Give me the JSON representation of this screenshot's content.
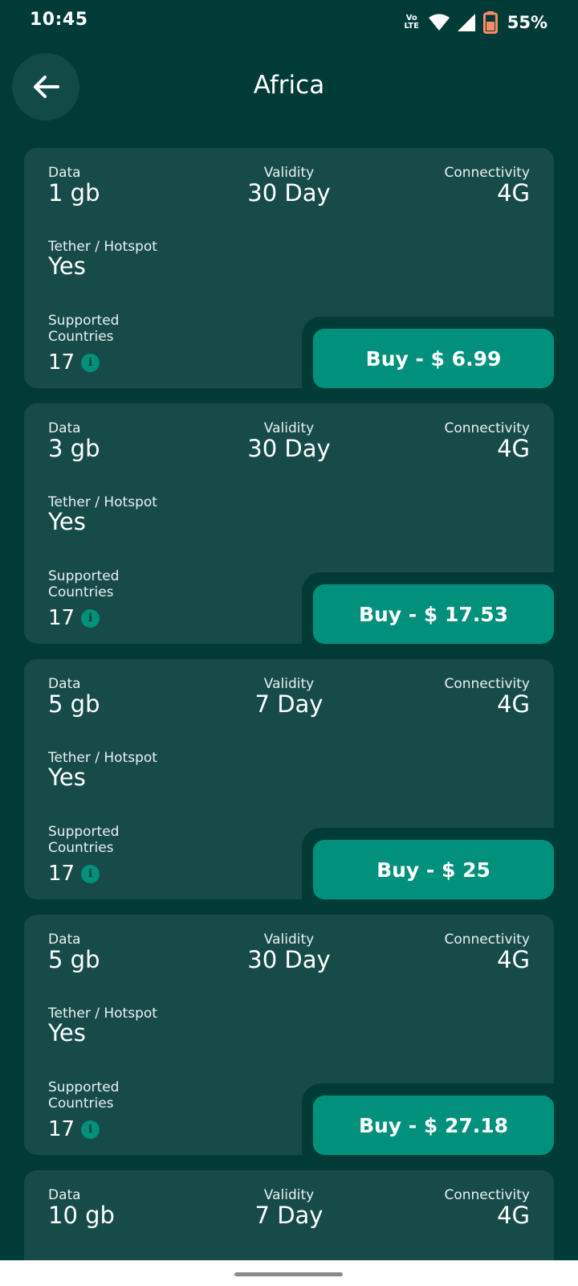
{
  "status": {
    "time": "10:45",
    "volte": "Vo LTE",
    "battery": "55%"
  },
  "header": {
    "title": "Africa",
    "back_icon": "arrow-left-icon"
  },
  "labels": {
    "data": "Data",
    "validity": "Validity",
    "connectivity": "Connectivity",
    "tether": "Tether / Hotspot",
    "supported": "Supported Countries"
  },
  "plans": [
    {
      "data": "1 gb",
      "validity": "30 Day",
      "connectivity": "4G",
      "tether": "Yes",
      "countries": "17",
      "buy": "Buy - $ 6.99"
    },
    {
      "data": "3 gb",
      "validity": "30 Day",
      "connectivity": "4G",
      "tether": "Yes",
      "countries": "17",
      "buy": "Buy - $ 17.53"
    },
    {
      "data": "5 gb",
      "validity": "7 Day",
      "connectivity": "4G",
      "tether": "Yes",
      "countries": "17",
      "buy": "Buy - $ 25"
    },
    {
      "data": "5 gb",
      "validity": "30 Day",
      "connectivity": "4G",
      "tether": "Yes",
      "countries": "17",
      "buy": "Buy - $ 27.18"
    },
    {
      "data": "10 gb",
      "validity": "7 Day",
      "connectivity": "4G"
    }
  ],
  "colors": {
    "background": "#003b38",
    "card": "#174b49",
    "accent": "#00907c"
  }
}
